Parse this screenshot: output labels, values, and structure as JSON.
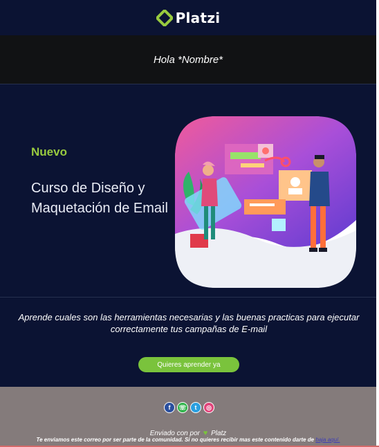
{
  "header": {
    "brand": "Platzi",
    "logo_icon": "platzi-logo-icon",
    "brand_color": "#98ca3f",
    "background": "#0b1333"
  },
  "greeting": {
    "text": "Hola *Nombre*"
  },
  "hero": {
    "badge": "Nuevo",
    "title": "Curso de Diseño y Maquetación de Email",
    "illustration": "email-design-illustration"
  },
  "description": {
    "text": "Aprende cuales son las herramientas necesarias y las buenas practicas para ejecutar correctamente tus campañas de E-mail",
    "cta_label": "Quieres aprender ya",
    "cta_color": "#7ac33c"
  },
  "footer": {
    "social_icons": [
      "facebook-icon",
      "whatsapp-icon",
      "twitter-icon",
      "instagram-icon"
    ],
    "sent_prefix": "Enviado con por",
    "sent_brand": "Platz",
    "note_text": "Te enviamos este correo por ser parte de la comunidad. Si no quieres recibir mas este contenido darte de",
    "unsubscribe_label": "baja aquí.",
    "background": "#847b7b"
  }
}
